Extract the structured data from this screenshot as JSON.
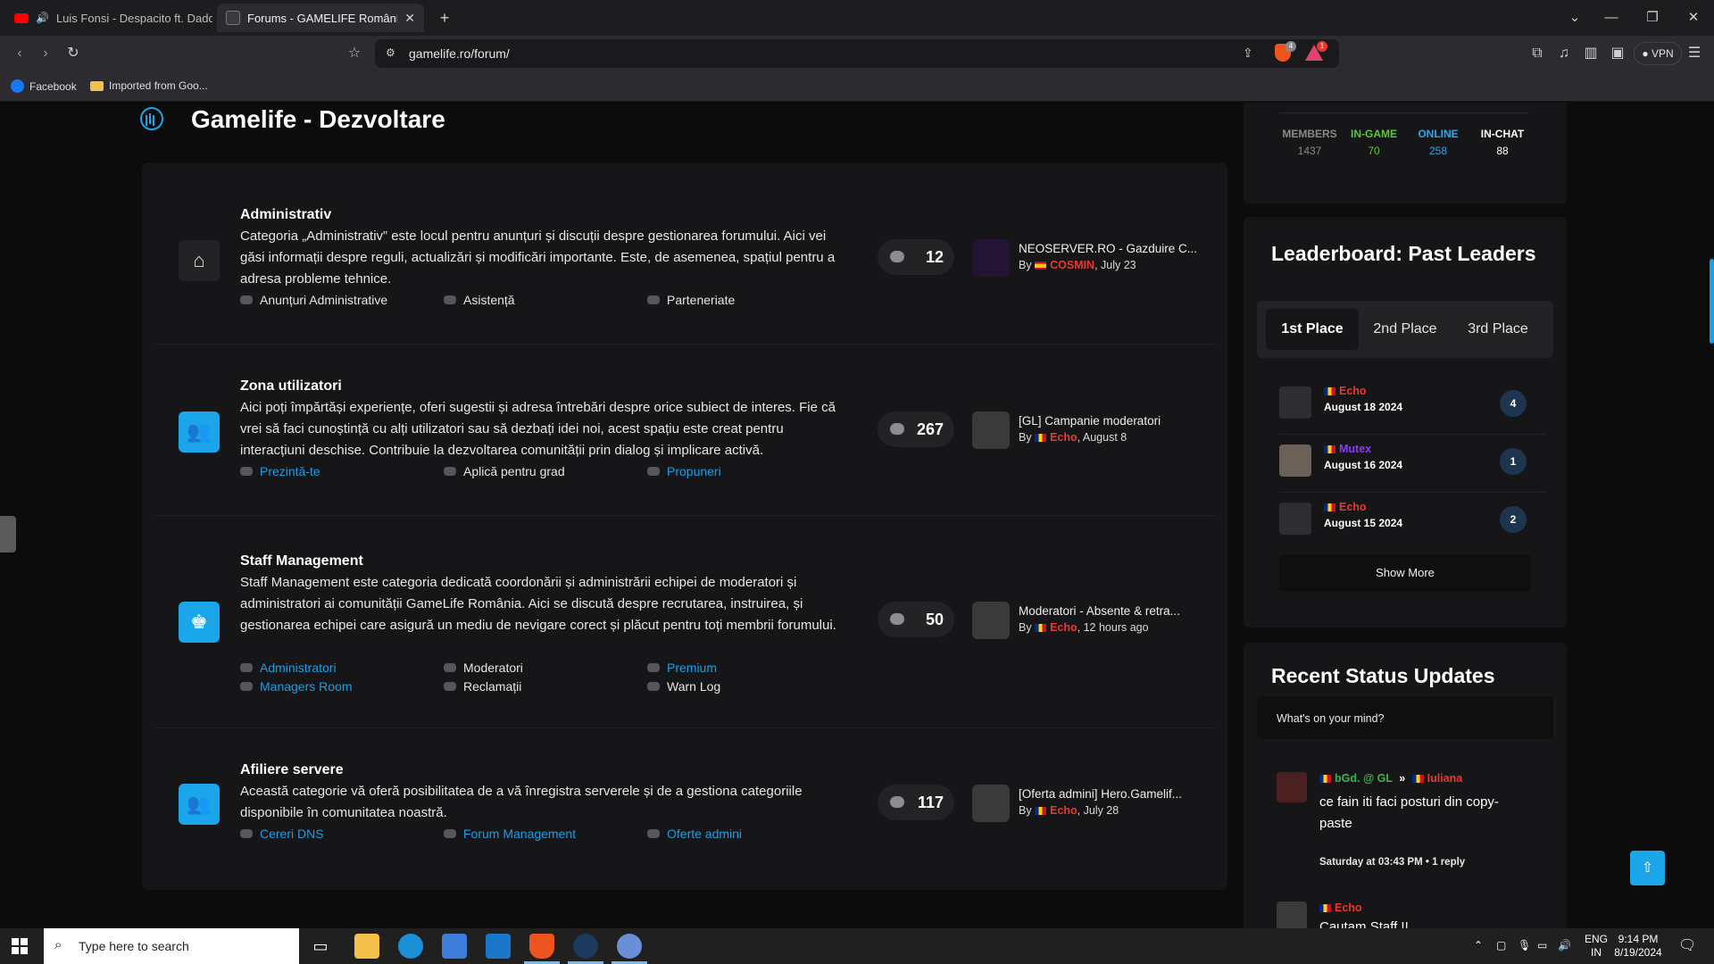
{
  "browser": {
    "tabs": [
      {
        "label": "Luis Fonsi - Despacito ft. Daddy",
        "active": false
      },
      {
        "label": "Forums - GAMELIFE România",
        "active": true
      }
    ],
    "new_tab": "+",
    "url": "gamelife.ro/forum/",
    "vpn_label": "VPN",
    "bookmarks": [
      {
        "label": "Facebook"
      },
      {
        "label": "Imported from Goo..."
      }
    ],
    "brave_badge": "4",
    "alert_badge": "1"
  },
  "section": {
    "title": "Gamelife - Dezvoltare"
  },
  "forums": [
    {
      "title": "Administrativ",
      "description": "Categoria „Administrativ” este locul pentru anunțuri și discuții despre gestionarea forumului. Aici vei găsi informații despre reguli, actualizări și modificări importante. Este, de asemenea, spațiul pentru a adresa probleme tehnice.",
      "icon": "home-icon",
      "subforums": [
        {
          "label": "Anunțuri Administrative",
          "link": false
        },
        {
          "label": "Asistență",
          "link": false
        },
        {
          "label": "Parteneriate",
          "link": false
        }
      ],
      "count": "12",
      "last_post": {
        "title": "NEOSERVER.RO - Gazduire C...",
        "by": "By",
        "user": "COSMIN",
        "when": ", July 23",
        "flag": "es"
      }
    },
    {
      "title": "Zona utilizatori",
      "description": "Aici poți împărtăși experiențe, oferi sugestii și adresa întrebări despre orice subiect de interes. Fie că vrei să faci cunoștință cu alți utilizatori sau să dezbați idei noi, acest spațiu este creat pentru interacțiuni deschise. Contribuie la dezvoltarea comunității prin dialog și implicare activă.",
      "icon": "users-icon",
      "subforums": [
        {
          "label": "Prezintă-te",
          "link": true
        },
        {
          "label": "Aplică pentru grad",
          "link": false
        },
        {
          "label": "Propuneri",
          "link": true
        }
      ],
      "count": "267",
      "last_post": {
        "title": "[GL] Campanie moderatori",
        "by": "By",
        "user": "Echo",
        "when": ", August 8",
        "flag": "ro"
      }
    },
    {
      "title": "Staff Management",
      "description": "Staff Management este categoria dedicată coordonării și administrării echipei de moderatori și administratori ai comunității GameLife România. Aici se discută despre recrutarea, instruirea, și gestionarea echipei care asigură un mediu de nevigare corect și plăcut pentru toți membrii forumului.",
      "icon": "staff-icon",
      "subforums": [
        {
          "label": "Administratori",
          "link": true
        },
        {
          "label": "Moderatori",
          "link": false
        },
        {
          "label": "Premium",
          "link": true
        },
        {
          "label": "Managers Room",
          "link": true
        },
        {
          "label": "Reclamații",
          "link": false
        },
        {
          "label": "Warn Log",
          "link": false
        }
      ],
      "count": "50",
      "last_post": {
        "title": "Moderatori - Absente & retra...",
        "by": "By",
        "user": "Echo",
        "when": ", 12 hours ago",
        "flag": "ro"
      }
    },
    {
      "title": "Afiliere servere",
      "description": "Această categorie vă oferă posibilitatea de a vă înregistra serverele și de a gestiona categoriile disponibile în comunitatea noastră.",
      "icon": "users-icon",
      "subforums": [
        {
          "label": "Cereri DNS",
          "link": true
        },
        {
          "label": "Forum Management",
          "link": true
        },
        {
          "label": "Oferte admini",
          "link": true
        }
      ],
      "count": "117",
      "last_post": {
        "title": "[Oferta admini] Hero.Gamelif...",
        "by": "By",
        "user": "Echo",
        "when": ", July 28",
        "flag": "ro"
      }
    }
  ],
  "stats": [
    {
      "label": "MEMBERS",
      "value": "1437",
      "color": "#8a8a8a",
      "value_color": "#8a8a8a"
    },
    {
      "label": "IN-GAME",
      "value": "70",
      "color": "#58c93a",
      "value_color": "#58c93a"
    },
    {
      "label": "ONLINE",
      "value": "258",
      "color": "#2ea7ee",
      "value_color": "#2ea7ee"
    },
    {
      "label": "IN-CHAT",
      "value": "88",
      "color": "#ffffff",
      "value_color": "#ffffff"
    }
  ],
  "leaderboard": {
    "title": "Leaderboard: Past Leaders",
    "tabs": [
      "1st Place",
      "2nd Place",
      "3rd Place"
    ],
    "active_tab": 0,
    "entries": [
      {
        "name": "Echo",
        "date": "August 18 2024",
        "count": "4",
        "color": "#e8382f"
      },
      {
        "name": "Mutex",
        "date": "August 16 2024",
        "count": "1",
        "color": "#8a3cf0"
      },
      {
        "name": "Echo",
        "date": "August 15 2024",
        "count": "2",
        "color": "#e8382f"
      }
    ],
    "show_more": "Show More"
  },
  "status_updates": {
    "title": "Recent Status Updates",
    "placeholder": "What's on your mind?",
    "posts": [
      {
        "author": "bGd. @ GL",
        "author_color": "#39b54a",
        "arrow": "»",
        "target": "Iuliana",
        "target_color": "#e8382f",
        "text": "ce fain iti faci posturi din copy-paste",
        "meta": "Saturday at 03:43 PM • 1 reply"
      },
      {
        "author": "Echo",
        "author_color": "#e8382f",
        "text": "Cautam Staff !!"
      }
    ]
  },
  "taskbar": {
    "search_placeholder": "Type here to search",
    "lang_line1": "ENG",
    "lang_line2": "IN",
    "time": "9:14 PM",
    "date": "8/19/2024"
  }
}
